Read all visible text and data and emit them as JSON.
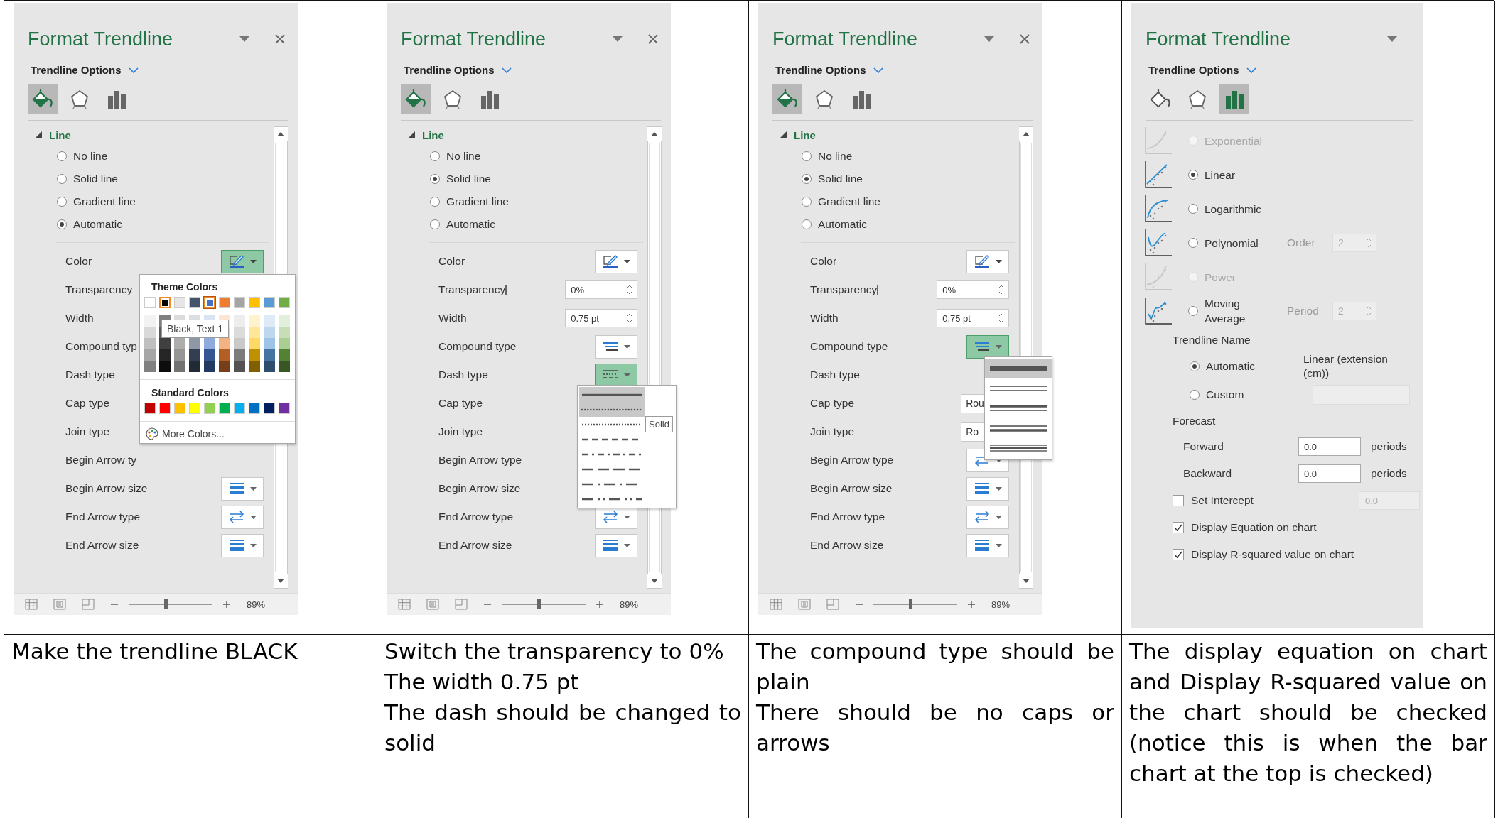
{
  "cells": [
    {
      "pane": {
        "title": "Format Trendline",
        "close_button": true,
        "menu_label": "Trendline Options",
        "tabs": [
          {
            "kind": "fill",
            "selected": true
          },
          {
            "kind": "effects",
            "selected": false
          },
          {
            "kind": "options",
            "selected": false
          }
        ],
        "section": {
          "title": "Line",
          "expanded": true
        },
        "radios": [
          {
            "label": "No line",
            "selected": false
          },
          {
            "label": "Solid line",
            "selected": false
          },
          {
            "label": "Gradient line",
            "selected": false
          },
          {
            "label": "Automatic",
            "selected": true
          }
        ],
        "properties": [
          {
            "label": "Color",
            "kind": "color",
            "active": true,
            "popup": {
              "kind": "color_picker",
              "theme_title": "Theme Colors",
              "theme_colors": [
                {
                  "color": "#ffffff",
                  "selected": false,
                  "hovered": false
                },
                {
                  "color": "#000000",
                  "selected": false,
                  "hovered": true
                },
                {
                  "color": "#e7e6e6",
                  "selected": false,
                  "hovered": false
                },
                {
                  "color": "#44546a",
                  "selected": false,
                  "hovered": false
                },
                {
                  "color": "#4472c4",
                  "selected": true,
                  "hovered": false
                },
                {
                  "color": "#ed7d31",
                  "selected": false,
                  "hovered": false
                },
                {
                  "color": "#a5a5a5",
                  "selected": false,
                  "hovered": false
                },
                {
                  "color": "#ffc000",
                  "selected": false,
                  "hovered": false
                },
                {
                  "color": "#5b9bd5",
                  "selected": false,
                  "hovered": false
                },
                {
                  "color": "#70ad47",
                  "selected": false,
                  "hovered": false
                }
              ],
              "tooltip": "Black, Text 1",
              "standard_title": "Standard Colors",
              "standard_colors": [
                {
                  "color": "#c00000"
                },
                {
                  "color": "#ff0000"
                },
                {
                  "color": "#ffc000"
                },
                {
                  "color": "#ffff00"
                },
                {
                  "color": "#92d050"
                },
                {
                  "color": "#00b050"
                },
                {
                  "color": "#00b0f0"
                },
                {
                  "color": "#0070c0"
                },
                {
                  "color": "#002060"
                },
                {
                  "color": "#7030a0"
                }
              ],
              "more_label": "More Colors..."
            }
          },
          {
            "label": "Transparency",
            "kind": "none"
          },
          {
            "label": "Width",
            "kind": "none"
          },
          {
            "label": "Compound typ",
            "kind": "none"
          },
          {
            "label": "Dash type",
            "kind": "none"
          },
          {
            "label": "Cap type",
            "kind": "none"
          },
          {
            "label": "Join type",
            "kind": "none"
          },
          {
            "label": "Begin Arrow ty",
            "kind": "none"
          },
          {
            "label": "Begin Arrow size",
            "kind": "arrow_size",
            "active": false
          },
          {
            "label": "End Arrow type",
            "kind": "arrow_type",
            "active": false
          },
          {
            "label": "End Arrow size",
            "kind": "arrow_size",
            "active": false
          }
        ],
        "status_bar": {
          "zoom": "89%",
          "level": 0.45
        }
      },
      "caption": [
        "Make the trendline BLACK"
      ]
    },
    {
      "pane": {
        "title": "Format Trendline",
        "close_button": true,
        "menu_label": "Trendline Options",
        "tabs": [
          {
            "kind": "fill",
            "selected": true
          },
          {
            "kind": "effects",
            "selected": false
          },
          {
            "kind": "options",
            "selected": false
          }
        ],
        "section": {
          "title": "Line",
          "expanded": true
        },
        "radios": [
          {
            "label": "No line",
            "selected": false
          },
          {
            "label": "Solid line",
            "selected": true
          },
          {
            "label": "Gradient line",
            "selected": false
          },
          {
            "label": "Automatic",
            "selected": false
          }
        ],
        "properties": [
          {
            "label": "Color",
            "kind": "color",
            "active": false
          },
          {
            "label": "Transparency",
            "kind": "slider_spin",
            "level": 0,
            "value": "0%"
          },
          {
            "label": "Width",
            "kind": "spin",
            "value": "0.75 pt"
          },
          {
            "label": "Compound type",
            "kind": "compound",
            "active": false
          },
          {
            "label": "Dash type",
            "kind": "dash",
            "active": true,
            "popup": {
              "kind": "dash_list",
              "tooltip": "Solid",
              "items": [
                {
                  "kind": "solid",
                  "highlighted": true
                },
                {
                  "kind": "round_dot",
                  "highlighted": true
                },
                {
                  "kind": "square_dot",
                  "highlighted": false
                },
                {
                  "kind": "dash",
                  "highlighted": false
                },
                {
                  "kind": "dash_dot",
                  "highlighted": false
                },
                {
                  "kind": "long_dash",
                  "highlighted": false
                },
                {
                  "kind": "long_dash_dot",
                  "highlighted": false
                },
                {
                  "kind": "long_dash_dot_dot",
                  "highlighted": false
                }
              ]
            }
          },
          {
            "label": "Cap type",
            "kind": "none"
          },
          {
            "label": "Join type",
            "kind": "none"
          },
          {
            "label": "Begin Arrow type",
            "kind": "none"
          },
          {
            "label": "Begin Arrow size",
            "kind": "none"
          },
          {
            "label": "End Arrow type",
            "kind": "arrow_type",
            "active": false
          },
          {
            "label": "End Arrow size",
            "kind": "arrow_size",
            "active": false
          }
        ],
        "status_bar": {
          "zoom": "89%",
          "level": 0.45
        }
      },
      "caption": [
        "Switch the transparency to 0%",
        "The width 0.75 pt",
        "The dash should be changed to solid"
      ]
    },
    {
      "pane": {
        "title": "Format Trendline",
        "close_button": true,
        "menu_label": "Trendline Options",
        "tabs": [
          {
            "kind": "fill",
            "selected": true
          },
          {
            "kind": "effects",
            "selected": false
          },
          {
            "kind": "options",
            "selected": false
          }
        ],
        "section": {
          "title": "Line",
          "expanded": true
        },
        "radios": [
          {
            "label": "No line",
            "selected": false
          },
          {
            "label": "Solid line",
            "selected": true
          },
          {
            "label": "Gradient line",
            "selected": false
          },
          {
            "label": "Automatic",
            "selected": false
          }
        ],
        "properties": [
          {
            "label": "Color",
            "kind": "color",
            "active": false
          },
          {
            "label": "Transparency",
            "kind": "slider_spin",
            "level": 0,
            "value": "0%"
          },
          {
            "label": "Width",
            "kind": "spin",
            "value": "0.75 pt"
          },
          {
            "label": "Compound type",
            "kind": "compound",
            "active": true,
            "popup": {
              "kind": "compound_list",
              "items": [
                {
                  "kind": "single",
                  "highlighted": true
                },
                {
                  "kind": "double",
                  "highlighted": false
                },
                {
                  "kind": "thick_thin",
                  "highlighted": false
                },
                {
                  "kind": "thin_thick",
                  "highlighted": false
                },
                {
                  "kind": "triple",
                  "highlighted": false
                }
              ]
            }
          },
          {
            "label": "Dash type",
            "kind": "none"
          },
          {
            "label": "Cap type",
            "kind": "select",
            "value": "Rou"
          },
          {
            "label": "Join type",
            "kind": "select",
            "value": "Ro"
          },
          {
            "label": "Begin Arrow type",
            "kind": "arrow_type",
            "active": false
          },
          {
            "label": "Begin Arrow size",
            "kind": "arrow_size",
            "active": false
          },
          {
            "label": "End Arrow type",
            "kind": "arrow_type",
            "active": false
          },
          {
            "label": "End Arrow size",
            "kind": "arrow_size",
            "active": false
          }
        ],
        "status_bar": {
          "zoom": "89%",
          "level": 0.45
        }
      },
      "caption": [
        "The compound type should be plain",
        "There should be no caps or arrows"
      ]
    },
    {
      "pane": {
        "title": "Format Trendline",
        "menu_label": "Trendline Options",
        "tabs": [
          {
            "kind": "fill",
            "selected": false
          },
          {
            "kind": "effects",
            "selected": false
          },
          {
            "kind": "options",
            "selected": true
          }
        ],
        "trend_types": [
          {
            "kind": "exponential",
            "label": "Exponential",
            "selected": false,
            "disabled": true
          },
          {
            "kind": "linear",
            "label": "Linear",
            "selected": true,
            "disabled": false
          },
          {
            "kind": "logarithmic",
            "label": "Logarithmic",
            "selected": false,
            "disabled": false
          },
          {
            "kind": "polynomial",
            "label": "Polynomial",
            "selected": false,
            "disabled": false,
            "param": {
              "label": "Order",
              "value": "2",
              "disabled": true
            }
          },
          {
            "kind": "power",
            "label": "Power",
            "selected": false,
            "disabled": true
          },
          {
            "kind": "moving_average",
            "label": "Moving Average",
            "selected": false,
            "disabled": false,
            "param": {
              "label": "Period",
              "value": "2",
              "disabled": true
            }
          }
        ],
        "name_heading": "Trendline Name",
        "name_options": [
          {
            "label": "Automatic",
            "selected": true,
            "value": "Linear (extension (cm))"
          },
          {
            "label": "Custom",
            "selected": false
          }
        ],
        "forecast_heading": "Forecast",
        "forecast": [
          {
            "label": "Forward",
            "value": "0.0",
            "unit": "periods"
          },
          {
            "label": "Backward",
            "value": "0.0",
            "unit": "periods"
          }
        ],
        "checks": [
          {
            "label": "Set Intercept",
            "checked": false,
            "value": "0.0"
          },
          {
            "label": "Display Equation on chart",
            "checked": true
          },
          {
            "label": "Display R-squared value on chart",
            "checked": true
          }
        ]
      },
      "caption": [
        "The display equation on chart and Display R-squared value on the chart should be checked (notice this is when the bar chart at the top is checked)"
      ]
    }
  ]
}
